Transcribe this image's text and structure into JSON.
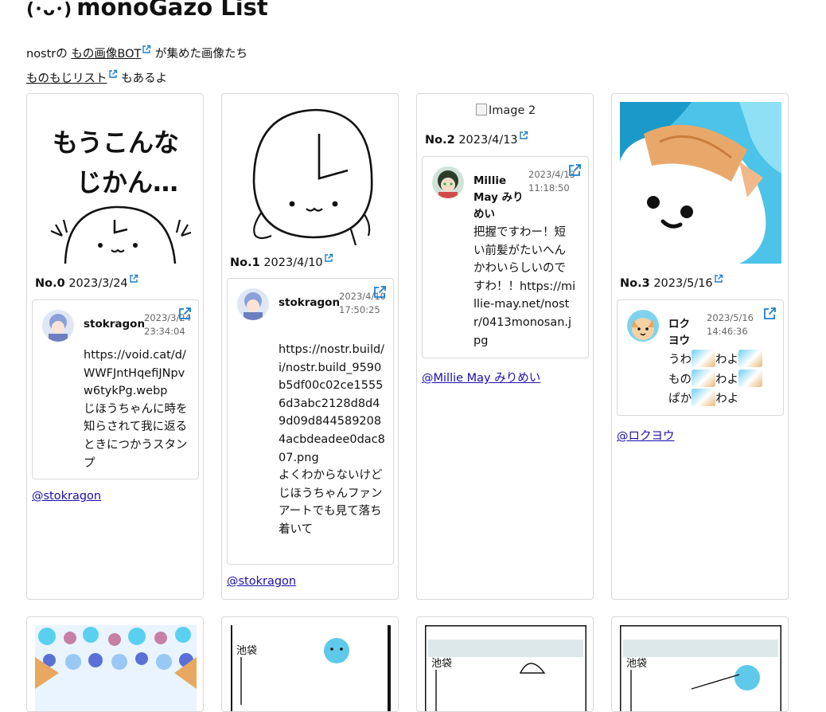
{
  "header": {
    "face": "(･ᴗ･)",
    "title": "monoGazo List"
  },
  "intro": {
    "line1_prefix": "nostrの",
    "line1_link": "もの画像BOT",
    "line1_suffix": "が集めた画像たち",
    "line2_link": "ものもじリスト",
    "line2_suffix": "もあるよ"
  },
  "cards": [
    {
      "no": "No.0",
      "date": "2023/3/24",
      "art_text_1": "もうこんな",
      "art_text_2": "じかん…",
      "author": "stokragon",
      "stamp_date": "2023/3/24",
      "stamp_time": "23:34:04",
      "content": "https://void.cat/d/WWFJntHqefiJNpvw6tykPg.webp\nじほうちゃんに時を知らされて我に返るときにつかうスタンプ",
      "handle": "@stokragon"
    },
    {
      "no": "No.1",
      "date": "2023/4/10",
      "author": "stokragon",
      "stamp_date": "2023/4/10",
      "stamp_time": "17:50:25",
      "content": "https://nostr.build/i/nostr.build_9590b5df00c02ce15556d3abc2128d8d49d09d8445892084acbdeadee0dac807.png\nよくわからないけど\nじほうちゃんファンアートでも見て落ち着いて",
      "handle": "@stokragon"
    },
    {
      "no": "No.2",
      "date": "2023/4/13",
      "alt": "Image 2",
      "author": "Millie May みりめい",
      "stamp_date": "2023/4/13",
      "stamp_time": "11:18:50",
      "content": "把握ですわー！短い前髪がたいへんかわいらしいのですわ！！https://millie-may.net/nostr/0413monosan.jpg",
      "handle": "@Millie May みりめい"
    },
    {
      "no": "No.3",
      "date": "2023/5/16",
      "author": "ロクヨウ",
      "stamp_date": "2023/5/16",
      "stamp_time": "14:46:36",
      "content_lines": [
        {
          "a": "うわ",
          "b": "わよ"
        },
        {
          "a": "もの",
          "b": "わよ"
        },
        {
          "a": "ぱか",
          "b": "わよ"
        }
      ],
      "handle": "@ロクヨウ"
    }
  ],
  "bottom_art_text": "池袋",
  "colors": {
    "link": "#1a0dab",
    "ext_icon": "#1a7fd4",
    "border": "#d8d8d8"
  }
}
